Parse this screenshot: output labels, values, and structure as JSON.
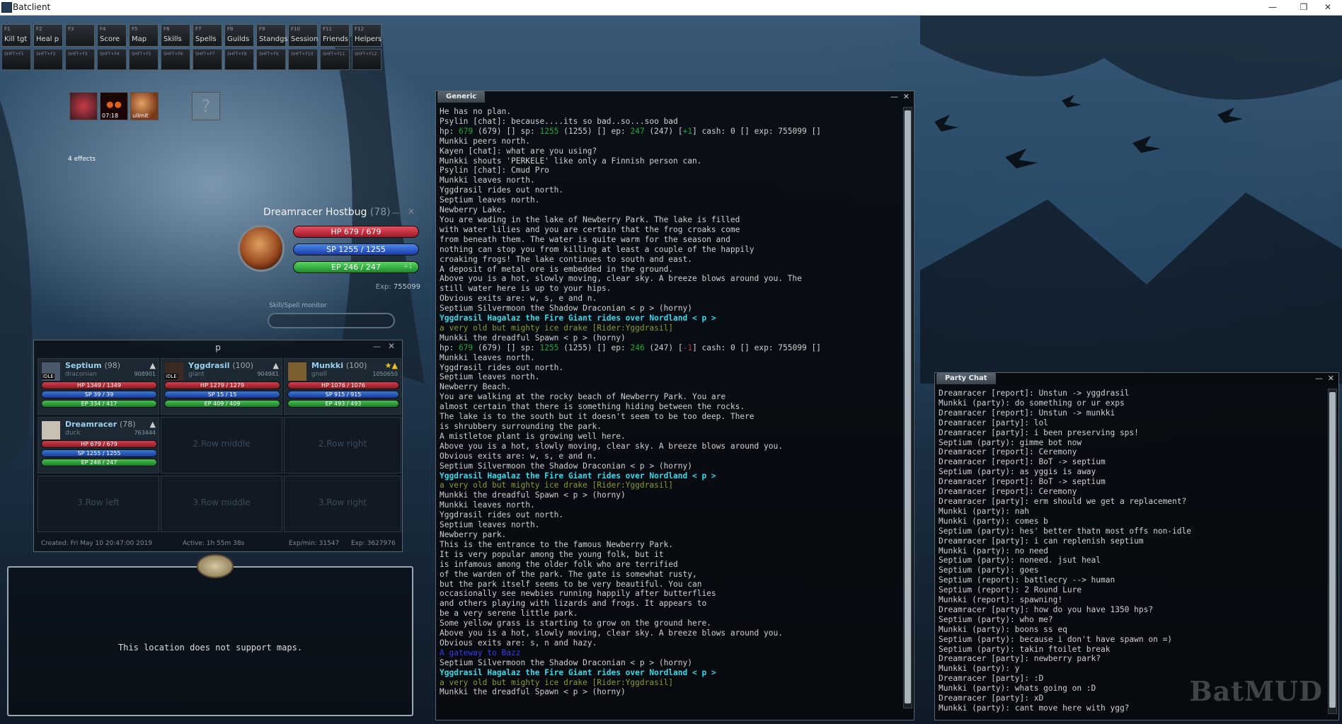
{
  "window": {
    "title": "Batclient",
    "min": "—",
    "max": "❐",
    "close": "✕"
  },
  "fkeys": [
    {
      "key": "F1",
      "label": "Kill tgt"
    },
    {
      "key": "F2",
      "label": "Heal p"
    },
    {
      "key": "F3",
      "label": ""
    },
    {
      "key": "F4",
      "label": "Score"
    },
    {
      "key": "F5",
      "label": "Map"
    },
    {
      "key": "F6",
      "label": "Skills"
    },
    {
      "key": "F7",
      "label": "Spells"
    },
    {
      "key": "F8",
      "label": "Guilds"
    },
    {
      "key": "F9",
      "label": "Standgs"
    },
    {
      "key": "F10",
      "label": "Session"
    },
    {
      "key": "F11",
      "label": "Friends"
    },
    {
      "key": "F12",
      "label": "Helpers"
    }
  ],
  "skeys": [
    "SHFT+F1",
    "SHFT+F2",
    "SHFT+F3",
    "SHFT+F4",
    "SHFT+F5",
    "SHFT+F6",
    "SHFT+F7",
    "SHFT+F8",
    "SHFT+F9",
    "SHFT+F10",
    "SHFT+F11",
    "SHFT+F12"
  ],
  "effects": {
    "items": [
      {
        "icon": "heart-icon",
        "text": "",
        "color": "#c83a4a"
      },
      {
        "icon": "eyes-icon",
        "text": "07:18",
        "color": "#3a0808"
      },
      {
        "icon": "moon-icon",
        "text": "ulimit",
        "color": "#b06838"
      },
      {
        "icon": "question-icon",
        "text": "",
        "color": "#6a7a88"
      }
    ],
    "count": "4 effects"
  },
  "player": {
    "name": "Dreamracer Hostbug",
    "level": "(78)",
    "hp": "HP  679 / 679",
    "sp": "SP  1255 / 1255",
    "ep": "EP  246 / 247",
    "ep_extra": "+1",
    "exp_label": "Exp:",
    "exp": "755099",
    "skill_monitor": "Skill/Spell monitor"
  },
  "party": {
    "title": "p",
    "members": [
      {
        "name": "Septium",
        "level": "(98)",
        "race": "draconian",
        "exp": "908901",
        "idle": "IDLE",
        "hp": "HP 1349 / 1349",
        "sp": "SP 39 / 39",
        "ep": "EP 334 / 417",
        "flag": "▲"
      },
      {
        "name": "Yggdrasil",
        "level": "(100)",
        "race": "giant",
        "exp": "904981",
        "idle": "IDLE",
        "hp": "HP 1279 / 1279",
        "sp": "SP 15 / 15",
        "ep": "EP 409 / 409",
        "flag": "▲"
      },
      {
        "name": "Munkki",
        "level": "(100)",
        "race": "gnoll",
        "exp": "1050650",
        "idle": "",
        "hp": "HP 1076 / 1076",
        "sp": "SP 915 / 915",
        "ep": "EP 493 / 493",
        "flag": "★▲"
      },
      {
        "name": "Dreamracer",
        "level": "(78)",
        "race": "duck",
        "exp": "763444",
        "idle": "",
        "hp": "HP 679 / 679",
        "sp": "SP 1255 / 1255",
        "ep": "EP 246 / 247",
        "flag": "▲"
      }
    ],
    "empty": [
      "2.Row middle",
      "2.Row right",
      "3.Row left",
      "3.Row middle",
      "3.Row right"
    ],
    "footer": {
      "created": "Created: Fri May 10 20:47:00 2019",
      "active": "Active: 1h 55m 38s",
      "expmin": "Exp/min: 31547",
      "exp": "Exp: 3627976"
    }
  },
  "map": {
    "message": "This location does not support maps."
  },
  "generic": {
    "tab": "Generic",
    "lines": [
      {
        "t": "He has no plan."
      },
      {
        "t": "Psylin [chat]: because....its so bad..so...soo bad"
      },
      {
        "segs": [
          {
            "t": "hp: "
          },
          {
            "t": "679",
            "c": "green"
          },
          {
            "t": " (679) [] sp: "
          },
          {
            "t": "1255",
            "c": "green"
          },
          {
            "t": " (1255) [] ep: "
          },
          {
            "t": "247",
            "c": "green"
          },
          {
            "t": " (247) ["
          },
          {
            "t": "+1",
            "c": "green"
          },
          {
            "t": "] cash: 0 [] exp: 755099 []"
          }
        ]
      },
      {
        "t": "Munkki peers north."
      },
      {
        "t": "Kayen [chat]: what are you using?"
      },
      {
        "t": "Munkki shouts 'PERKELE' like only a Finnish person can."
      },
      {
        "t": "Psylin [chat]: Cmud Pro"
      },
      {
        "t": "Munkki leaves north."
      },
      {
        "t": "Yggdrasil rides out north."
      },
      {
        "t": "Septium leaves north."
      },
      {
        "t": "Newberry Lake."
      },
      {
        "t": "You are wading in the lake of Newberry Park. The lake is filled"
      },
      {
        "t": "with water lilies and you are certain that the frog croaks come"
      },
      {
        "t": "from beneath them. The water is quite warm for the season and"
      },
      {
        "t": "nothing can stop you from killing at least a couple of the happily"
      },
      {
        "t": "croaking frogs! The lake continues to south and east."
      },
      {
        "t": "A deposit of metal ore is embedded in the ground."
      },
      {
        "t": "Above you is a hot, slowly moving, clear sky. A breeze blows around you. The"
      },
      {
        "t": "still water here is up to your hips."
      },
      {
        "t": "Obvious exits are: w, s, e and n."
      },
      {
        "t": "Septium Silvermoon the Shadow Draconian < p > (horny)"
      },
      {
        "t": "Yggdrasil Hagalaz the Fire Giant rides over Nordland < p >",
        "c": "cyan"
      },
      {
        "t": "a very old but mighty ice drake [Rider:Yggdrasil]",
        "c": "olive"
      },
      {
        "t": "Munkki the dreadful Spawn < p > (horny)"
      },
      {
        "segs": [
          {
            "t": "hp: "
          },
          {
            "t": "679",
            "c": "green"
          },
          {
            "t": " (679) [] sp: "
          },
          {
            "t": "1255",
            "c": "green"
          },
          {
            "t": " (1255) [] ep: "
          },
          {
            "t": "246",
            "c": "green"
          },
          {
            "t": " (247) ["
          },
          {
            "t": "-1",
            "c": "red"
          },
          {
            "t": "] cash: 0 [] exp: 755099 []"
          }
        ]
      },
      {
        "t": "Munkki leaves north."
      },
      {
        "t": "Yggdrasil rides out north."
      },
      {
        "t": "Septium leaves north."
      },
      {
        "t": "Newberry Beach."
      },
      {
        "t": "You are walking at the rocky beach of Newberry Park. You are"
      },
      {
        "t": "almost certain that there is something hiding between the rocks."
      },
      {
        "t": "The lake is to the south but it doesn't seem to be too deep. There"
      },
      {
        "t": "is shrubbery surrounding the park."
      },
      {
        "t": "A mistletoe plant is growing well here."
      },
      {
        "t": "Above you is a hot, slowly moving, clear sky. A breeze blows around you."
      },
      {
        "t": "Obvious exits are: w, s, e and n."
      },
      {
        "t": "Septium Silvermoon the Shadow Draconian < p > (horny)"
      },
      {
        "t": "Yggdrasil Hagalaz the Fire Giant rides over Nordland < p >",
        "c": "cyan"
      },
      {
        "t": "a very old but mighty ice drake [Rider:Yggdrasil]",
        "c": "olive"
      },
      {
        "t": "Munkki the dreadful Spawn < p > (horny)"
      },
      {
        "t": "Munkki leaves north."
      },
      {
        "t": "Yggdrasil rides out north."
      },
      {
        "t": "Septium leaves north."
      },
      {
        "t": "Newberry park."
      },
      {
        "t": "This is the entrance to the famous Newberry Park."
      },
      {
        "t": "It is very popular among the young folk, but it"
      },
      {
        "t": "is infamous among the older folk who are terrified"
      },
      {
        "t": "of the warden of the park. The gate is somewhat rusty,"
      },
      {
        "t": "but the park itself seems to be very beautiful. You can"
      },
      {
        "t": "occasionally see newbies running happily after butterflies"
      },
      {
        "t": "and others playing with lizards and frogs. It appears to"
      },
      {
        "t": "be a very serene little park."
      },
      {
        "t": "Some yellow grass is starting to grow on the ground here."
      },
      {
        "t": "Above you is a hot, slowly moving, clear sky. A breeze blows around you."
      },
      {
        "t": "Obvious exits are: s, n and hazy."
      },
      {
        "t": "A gateway to Bazz",
        "c": "blue"
      },
      {
        "t": "Septium Silvermoon the Shadow Draconian < p > (horny)"
      },
      {
        "t": "Yggdrasil Hagalaz the Fire Giant rides over Nordland < p >",
        "c": "cyan"
      },
      {
        "t": "a very old but mighty ice drake [Rider:Yggdrasil]",
        "c": "olive"
      },
      {
        "t": "Munkki the dreadful Spawn < p > (horny)"
      }
    ]
  },
  "partychat": {
    "tab": "Party Chat",
    "lines": [
      "Dreamracer [report]: Unstun -> yggdrasil",
      "Munkki (party): do something or ur exps",
      "Dreamracer [report]: Unstun -> munkki",
      "Dreamracer [party]: lol",
      "Dreamracer [party]: i been preserving sps!",
      "Septium (party): gimme bot now",
      "Dreamracer [report]: Ceremony",
      "Dreamracer [report]: BoT -> septium",
      "Septium (party): as yggis is away",
      "Dreamracer [report]: BoT -> septium",
      "Dreamracer [report]: Ceremony",
      "Dreamracer [party]: erm should we get a replacement?",
      "Munkki (party): nah",
      "Munkki (party): comes b",
      "Septium (party): hes' better thatn most offs non-idle",
      "Dreamracer [party]: i can replenish septium",
      "Munkki (party): no need",
      "Septium (party): noneed. jsut heal",
      "Septium (party): goes",
      "Septium (report): battlecry --> human",
      "Septium (report): 2 Round Lure",
      "Munkki (report): spawning!",
      "Dreamracer [party]: how do you have 1350 hps?",
      "Septium (party): who me?",
      "Munkki (party): boons ss eq",
      "Septium (party): because i don't have spawn on =)",
      "Septium (party): takin ftoilet break",
      "Dreamracer [party]: newberry park?",
      "Munkki (party): y",
      "Dreamracer [party]: :D",
      "Munkki (party): whats going on :D",
      "Dreamracer [party]: xD",
      "Munkki (party): cant move here with ygg?"
    ]
  },
  "logo": {
    "text": "BatMUD"
  }
}
